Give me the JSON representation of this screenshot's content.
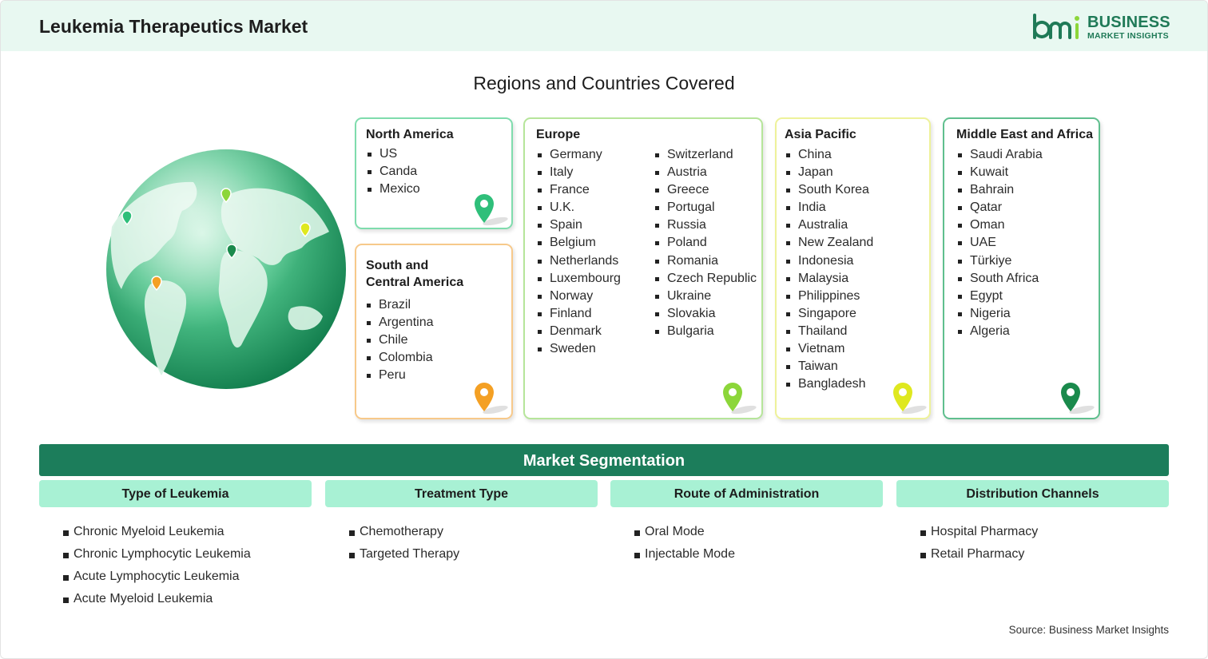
{
  "header": {
    "title": "Leukemia Therapeutics Market",
    "logo_line1": "BUSINESS",
    "logo_line2": "MARKET INSIGHTS"
  },
  "regions": {
    "title": "Regions and Countries Covered",
    "north_america": {
      "name": "North America",
      "countries": [
        "US",
        "Canda",
        "Mexico"
      ]
    },
    "south_america": {
      "name_line1": "South and",
      "name_line2": "Central America",
      "countries": [
        "Brazil",
        "Argentina",
        "Chile",
        "Colombia",
        "Peru"
      ]
    },
    "europe": {
      "name": "Europe",
      "countries_col1": [
        "Germany",
        "Italy",
        "France",
        "U.K.",
        "Spain",
        "Belgium",
        "Netherlands",
        "Luxembourg",
        "Norway",
        "Finland",
        "Denmark",
        "Sweden"
      ],
      "countries_col2": [
        "Switzerland",
        "Austria",
        "Greece",
        "Portugal",
        "Russia",
        "Poland",
        "Romania",
        "Czech Republic",
        "Ukraine",
        "Slovakia",
        "Bulgaria"
      ]
    },
    "asia_pacific": {
      "name": "Asia Pacific",
      "countries": [
        "China",
        "Japan",
        "South Korea",
        "India",
        "Australia",
        "New Zealand",
        "Indonesia",
        "Malaysia",
        "Philippines",
        "Singapore",
        "Thailand",
        "Vietnam",
        "Taiwan",
        "Bangladesh"
      ]
    },
    "mea": {
      "name": "Middle East and Africa",
      "countries": [
        "Saudi Arabia",
        "Kuwait",
        "Bahrain",
        "Qatar",
        "Oman",
        "UAE",
        "Türkiye",
        "South Africa",
        "Egypt",
        "Nigeria",
        "Algeria"
      ]
    }
  },
  "colors": {
    "north_america": "#2fbf7a",
    "south_america": "#f4a024",
    "europe": "#8cd63a",
    "asia_pacific": "#dfe81f",
    "mea": "#1a8a4c"
  },
  "segmentation": {
    "title": "Market Segmentation",
    "columns": [
      {
        "heading": "Type of Leukemia",
        "items": [
          "Chronic Myeloid Leukemia",
          "Chronic Lymphocytic Leukemia",
          "Acute Lymphocytic Leukemia",
          "Acute Myeloid Leukemia"
        ]
      },
      {
        "heading": "Treatment Type",
        "items": [
          "Chemotherapy",
          "Targeted Therapy"
        ]
      },
      {
        "heading": "Route of Administration",
        "items": [
          "Oral Mode",
          "Injectable Mode"
        ]
      },
      {
        "heading": "Distribution Channels",
        "items": [
          "Hospital Pharmacy",
          "Retail Pharmacy"
        ]
      }
    ]
  },
  "source": "Source: Business Market Insights"
}
